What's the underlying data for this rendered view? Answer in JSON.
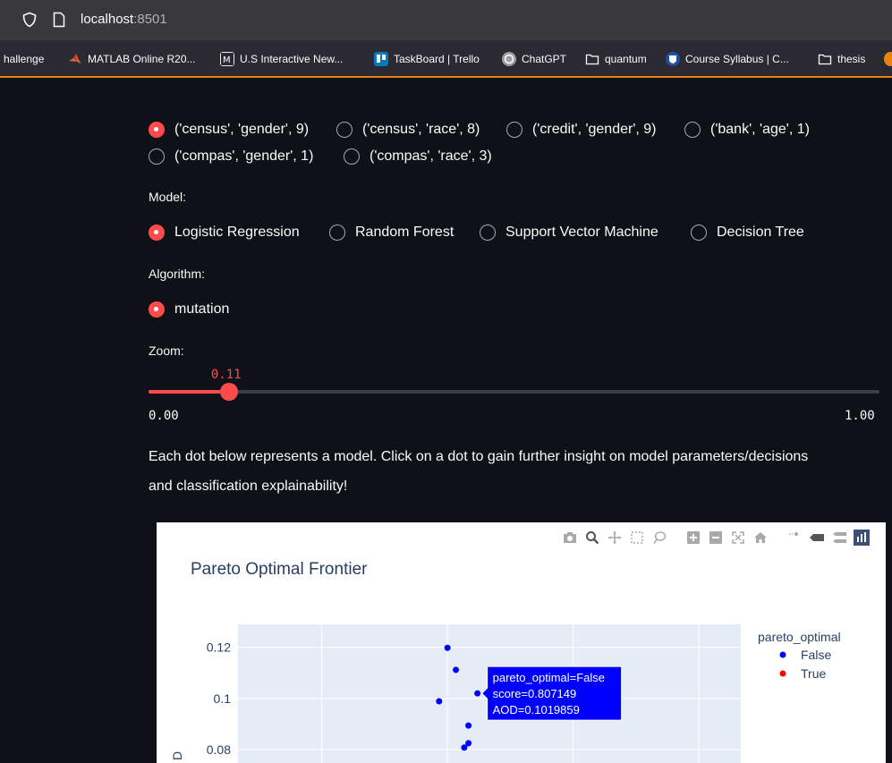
{
  "browser": {
    "url_host": "localhost",
    "url_port": ":8501",
    "bookmarks": [
      {
        "label": "hallenge",
        "icon": "none"
      },
      {
        "label": "MATLAB Online R20...",
        "icon": "matlab-icon"
      },
      {
        "label": "U.S Interactive New...",
        "icon": "news-icon"
      },
      {
        "label": "TaskBoard | Trello",
        "icon": "trello-icon"
      },
      {
        "label": "ChatGPT",
        "icon": "chatgpt-icon"
      },
      {
        "label": "quantum",
        "icon": "folder-icon"
      },
      {
        "label": "Course Syllabus | C...",
        "icon": "course-icon"
      },
      {
        "label": "thesis",
        "icon": "folder-icon"
      }
    ]
  },
  "dataset": {
    "options": [
      "('census', 'gender', 9)",
      "('census', 'race', 8)",
      "('credit', 'gender', 9)",
      "('bank', 'age', 1)",
      "('compas', 'gender', 1)",
      "('compas', 'race', 3)"
    ],
    "selected": 0
  },
  "model": {
    "label": "Model:",
    "options": [
      "Logistic Regression",
      "Random Forest",
      "Support Vector Machine",
      "Decision Tree"
    ],
    "selected": 0
  },
  "algorithm": {
    "label": "Algorithm:",
    "options": [
      "mutation"
    ],
    "selected": 0
  },
  "zoom": {
    "label": "Zoom:",
    "value": 0.11,
    "value_text": "0.11",
    "min_text": "0.00",
    "max_text": "1.00"
  },
  "description": {
    "line1": "Each dot below represents a model. Click on a dot to gain further insight on model parameters/decisions",
    "line2": "and classification explainability!"
  },
  "chart_data": {
    "type": "scatter",
    "title": "Pareto Optimal Frontier",
    "ylabel": "D",
    "yticks": [
      "0.12",
      "0.1",
      "0.08"
    ],
    "ylim": [
      0.073,
      0.129
    ],
    "xlim": [
      0.75,
      0.87
    ],
    "grid": true,
    "legend": {
      "title": "pareto_optimal",
      "placement": "right",
      "entries": [
        {
          "name": "False",
          "color": "#0000ff"
        },
        {
          "name": "True",
          "color": "#ff0000"
        }
      ]
    },
    "series": [
      {
        "name": "False",
        "color": "#0000ff",
        "points": [
          {
            "x": 0.8,
            "y": 0.1198
          },
          {
            "x": 0.802,
            "y": 0.1112
          },
          {
            "x": 0.807149,
            "y": 0.1019859
          },
          {
            "x": 0.798,
            "y": 0.0989
          },
          {
            "x": 0.805,
            "y": 0.0894
          },
          {
            "x": 0.805,
            "y": 0.0825
          },
          {
            "x": 0.804,
            "y": 0.0808
          }
        ]
      },
      {
        "name": "True",
        "color": "#ff0000",
        "points": []
      }
    ],
    "hover": {
      "lines": [
        "pareto_optimal=False",
        "score=0.807149",
        "AOD=0.1019859"
      ],
      "point_index": 2
    }
  }
}
